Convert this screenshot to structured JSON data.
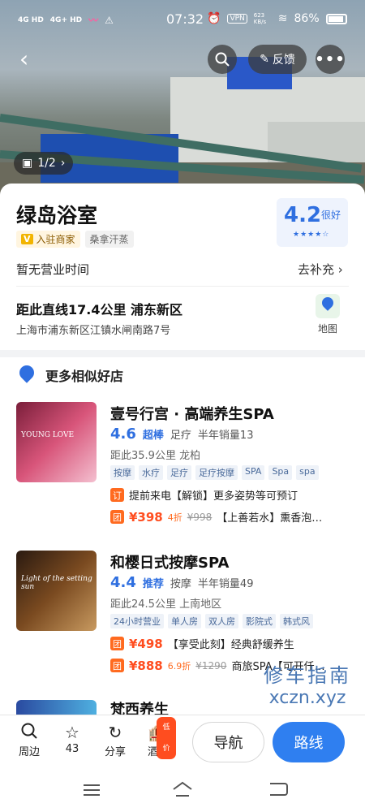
{
  "status_bar": {
    "signal1": "4G HD",
    "signal2": "4G+ HD",
    "time": "07:32",
    "vpn": "VPN",
    "speed": "623 KB/s",
    "battery": "86%"
  },
  "header": {
    "feedback_label": "反馈",
    "photo_count": "1/2"
  },
  "place": {
    "name": "绿岛浴室",
    "merchant_badge": "V",
    "merchant_label": "入驻商家",
    "category": "桑拿汗蒸",
    "rating": "4.2",
    "rating_grade": "很好",
    "rating_stars": 4,
    "hours_text": "暂无营业时间",
    "hours_action": "去补充",
    "distance": "距此直线17.4公里  浦东新区",
    "address": "上海市浦东新区江镇水闸南路7号",
    "map_label": "地图"
  },
  "section": {
    "title": "更多相似好店"
  },
  "shops": [
    {
      "name": "壹号行宫 · 高端养生SPA",
      "rating": "4.6",
      "grade": "超棒",
      "category": "足疗",
      "sales": "半年销量13",
      "distance": "距此35.9公里  龙柏",
      "thumb_text": "YOUNG LOVE",
      "tags": [
        "按摩",
        "水疗",
        "足疗",
        "足疗按摩",
        "SPA",
        "Spa",
        "spa"
      ],
      "deals": [
        {
          "icon": "订",
          "text": "提前来电【解锁】更多姿势等可预订"
        },
        {
          "icon": "团",
          "price": "¥398",
          "discount": "4折",
          "original": "¥998",
          "text": "【上善若水】熏香泡…"
        }
      ]
    },
    {
      "name": "和樱日式按摩SPA",
      "rating": "4.4",
      "grade": "推荐",
      "category": "按摩",
      "sales": "半年销量49",
      "distance": "距此24.5公里  上南地区",
      "thumb_text": "Light of the setting sun",
      "tags": [
        "24小时营业",
        "单人房",
        "双人房",
        "影院式",
        "韩式风"
      ],
      "deals": [
        {
          "icon": "团",
          "price": "¥498",
          "text": "【享受此刻】经典舒缓养生"
        },
        {
          "icon": "团",
          "price": "¥888",
          "discount": "6.9折",
          "original": "¥1290",
          "text": "商旅SPA【可开仟…"
        }
      ]
    }
  ],
  "peek_shop": {
    "name": "梵西养生"
  },
  "watermark": {
    "line1": "修车指南",
    "line2": "xczn.xyz"
  },
  "toolbar": {
    "nearby": "周边",
    "favorites_count": "43",
    "share": "分享",
    "hotel": "酒店",
    "hotel_badge": "低价",
    "navigate": "导航",
    "route": "路线"
  }
}
